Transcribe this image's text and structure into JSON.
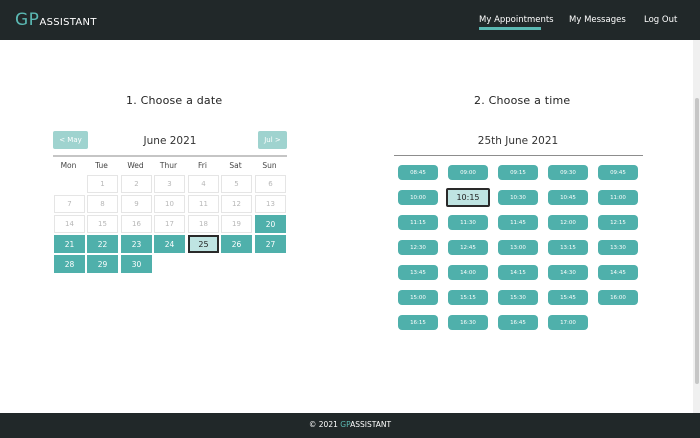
{
  "brand": {
    "prefix": "GP",
    "suffix": "ASSISTANT",
    "accent": "#5bb9b3"
  },
  "nav": {
    "appointments": "My Appointments",
    "messages": "My Messages",
    "logout": "Log Out",
    "active": "My Appointments"
  },
  "date_section": {
    "heading": "1. Choose a date",
    "prev_label": "< May",
    "next_label": "Jul >",
    "month_label": "June 2021",
    "weekdays": [
      "Mon",
      "Tue",
      "Wed",
      "Thur",
      "Fri",
      "Sat",
      "Sun"
    ],
    "days": [
      "1",
      "2",
      "3",
      "4",
      "5",
      "6",
      "7",
      "8",
      "9",
      "10",
      "11",
      "12",
      "13",
      "14",
      "15",
      "16",
      "17",
      "18",
      "19",
      "20",
      "21",
      "22",
      "23",
      "24",
      "25",
      "26",
      "27",
      "28",
      "29",
      "30"
    ],
    "first_weekday_index": 1,
    "first_available_day": 20,
    "selected_day": 25
  },
  "time_section": {
    "heading": "2. Choose a time",
    "date_label": "25th June 2021",
    "slots": [
      "08:45",
      "09:00",
      "09:15",
      "09:30",
      "09:45",
      "10:00",
      "10:15",
      "10:30",
      "10:45",
      "11:00",
      "11:15",
      "11:30",
      "11:45",
      "12:00",
      "12:15",
      "12:30",
      "12:45",
      "13:00",
      "13:15",
      "13:30",
      "13:45",
      "14:00",
      "14:15",
      "14:30",
      "14:45",
      "15:00",
      "15:15",
      "15:30",
      "15:45",
      "16:00",
      "16:15",
      "16:30",
      "16:45",
      "17:00"
    ],
    "selected": "10:15"
  },
  "footer": {
    "copyright": "© 2021 ",
    "brand_prefix": "GP",
    "brand_suffix": "ASSISTANT"
  },
  "colors": {
    "header_bg": "#212829",
    "accent": "#4fb0ab",
    "selected_bg": "#bfe4e2",
    "month_button": "#9fd3cf"
  }
}
